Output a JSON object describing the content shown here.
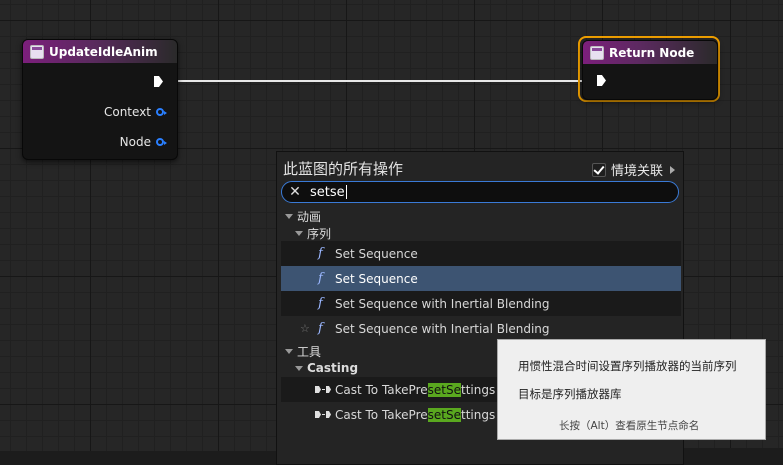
{
  "nodes": {
    "update_idle_anim": {
      "title": "UpdateIdleAnim",
      "pins": [
        "Context",
        "Node"
      ]
    },
    "return_node": {
      "title": "Return Node"
    }
  },
  "action_menu": {
    "title": "此蓝图的所有操作",
    "context_sensitive_label": "情境关联",
    "context_sensitive_checked": true,
    "search": {
      "value": "setse"
    },
    "categories": {
      "animation": "动画",
      "sequence": "序列",
      "tools": "工具",
      "casting": "Casting"
    },
    "sequence_items": [
      "Set Sequence",
      "Set Sequence",
      "Set Sequence with Inertial Blending",
      "Set Sequence with Inertial Blending"
    ],
    "casting_items": [
      {
        "pre": "Cast To TakePre",
        "hl1": "set",
        "mid": "Se",
        "hl2": "",
        "post": "ttings"
      },
      {
        "pre": "Cast To TakePre",
        "hl1": "set",
        "mid": "Se",
        "hl2": "",
        "post": "ttings"
      }
    ],
    "selected_index": 1
  },
  "tooltip": {
    "line1": "用惯性混合时间设置序列播放器的当前序列",
    "line2": "目标是序列播放器库",
    "line3": "长按（Alt）查看原生节点命名"
  },
  "colors": {
    "accent": "#3a7ad6",
    "node_header": "#7c1f7c",
    "selected_row": "#3d5472",
    "highlight": "#5aa81f",
    "pin_blue": "#2a7fff",
    "selection_border": "#f0a000"
  },
  "icons": {
    "node": "function-node-icon",
    "exec": "exec-pin-icon",
    "function": "function-f-icon",
    "cast": "cast-node-icon",
    "clear": "clear-x-icon",
    "star": "favorite-star-icon"
  }
}
